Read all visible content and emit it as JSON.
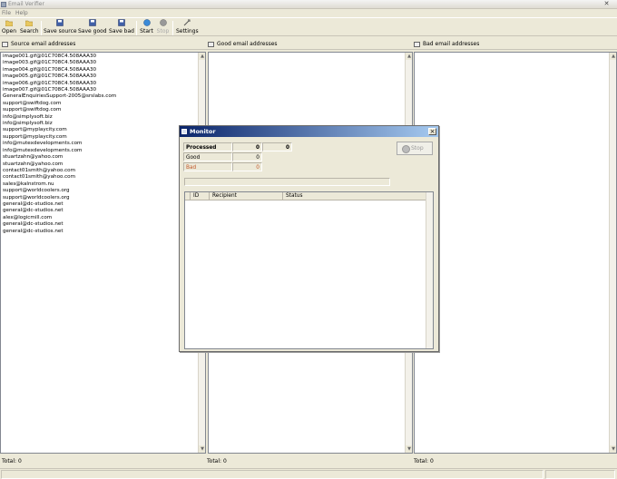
{
  "window": {
    "title": "Email Verifier"
  },
  "menu": [
    {
      "label": "File"
    },
    {
      "label": "Help"
    }
  ],
  "toolbar": {
    "open": "Open",
    "search": "Search",
    "save_source": "Save source",
    "save_good": "Save good",
    "save_bad": "Save bad",
    "start": "Start",
    "stop": "Stop",
    "settings": "Settings"
  },
  "panes": {
    "source": {
      "header": "Source email addresses",
      "status": "Total: 0",
      "items": [
        "image001.gif@01C708C4.508AAA30",
        "image003.gif@01C708C4.508AAA30",
        "image004.gif@01C708C4.508AAA30",
        "image005.gif@01C708C4.508AAA30",
        "image006.gif@01C708C4.508AAA30",
        "image007.gif@01C708C4.508AAA30",
        "GeneralEnquiriesSupport-2005@srslabs.com",
        "support@swiftdog.com",
        "support@swiftdog.com",
        "info@simplysoft.biz",
        "info@simplysoft.biz",
        "support@myplaycity.com",
        "support@myplaycity.com",
        "info@mutexdevelopments.com",
        "info@mutexdevelopments.com",
        "stuartzahn@yahoo.com",
        "stuartzahn@yahoo.com",
        "contact01smith@yahoo.com",
        "contact01smith@yahoo.com",
        "sales@kalnstrom.nu",
        "support@worldcoolers.org",
        "support@worldcoolers.org",
        "general@dc-studios.net",
        "general@dc-studios.net",
        "alex@logicmill.com",
        "general@dc-studios.net",
        "general@dc-studios.net"
      ]
    },
    "good": {
      "header": "Good email addresses",
      "status": "Total: 0"
    },
    "bad": {
      "header": "Bad email addresses",
      "status": "Total: 0"
    }
  },
  "monitor": {
    "title": "Monitor",
    "processed_label": "Processed",
    "processed_value": "0",
    "processed_total": "0",
    "good_label": "Good",
    "good_value": "0",
    "bad_label": "Bad",
    "bad_value": "0",
    "stop_label": "Stop",
    "progress": 0,
    "columns": [
      "ID",
      "Recipient",
      "Status"
    ]
  },
  "colors": {
    "bad_text": "#c0582a",
    "title_bar": "#0a246a"
  }
}
